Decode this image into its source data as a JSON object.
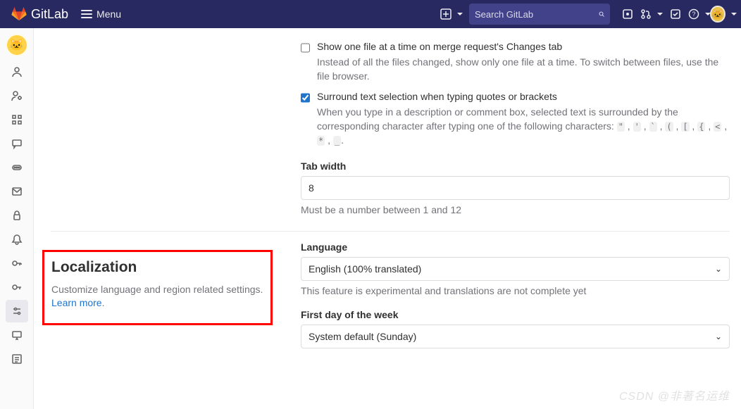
{
  "header": {
    "brand": "GitLab",
    "menu_label": "Menu",
    "search_placeholder": "Search GitLab"
  },
  "behavior": {
    "show_one_file": {
      "label": "Show one file at a time on merge request's Changes tab",
      "help": "Instead of all the files changed, show only one file at a time. To switch between files, use the file browser."
    },
    "surround": {
      "label": "Surround text selection when typing quotes or brackets",
      "help_prefix": "When you type in a description or comment box, selected text is surrounded by the corresponding character after typing one of the following characters: ",
      "chars": [
        "\"",
        "'",
        "`",
        "(",
        "[",
        "{",
        "<",
        "*",
        "_"
      ]
    },
    "tab_width": {
      "label": "Tab width",
      "value": "8",
      "hint": "Must be a number between 1 and 12"
    }
  },
  "localization": {
    "title": "Localization",
    "desc": "Customize language and region related settings. ",
    "learn_more": "Learn more",
    "language_label": "Language",
    "language_value": "English (100% translated)",
    "language_hint": "This feature is experimental and translations are not complete yet",
    "first_day_label": "First day of the week",
    "first_day_value": "System default (Sunday)"
  },
  "watermark": "CSDN @非著名运维"
}
